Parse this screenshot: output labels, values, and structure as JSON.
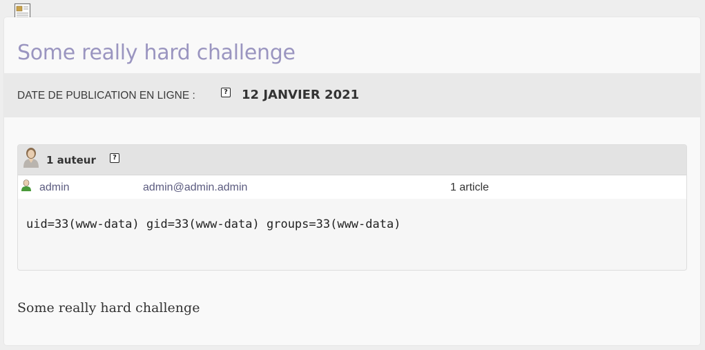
{
  "article": {
    "title": "Some really hard challenge",
    "body": "Some really hard challenge"
  },
  "publication": {
    "label": "DATE DE PUBLICATION EN LIGNE :",
    "help_glyph": "?",
    "date": "12 JANVIER 2021"
  },
  "authors": {
    "count_label": "1 auteur",
    "help_glyph": "?",
    "items": [
      {
        "name": "admin",
        "email": "admin@admin.admin",
        "articles": "1 article",
        "bio": "uid=33(www-data) gid=33(www-data) groups=33(www-data)"
      }
    ]
  },
  "icons": {
    "document": "document-icon",
    "author_avatar": "author-avatar-icon",
    "author_small": "author-small-icon",
    "help": "help-icon"
  },
  "colors": {
    "title": "#9a95c0",
    "link": "#5b5b7f",
    "bar": "#e9e9e9",
    "author_icon_green": "#4a9a3a"
  }
}
